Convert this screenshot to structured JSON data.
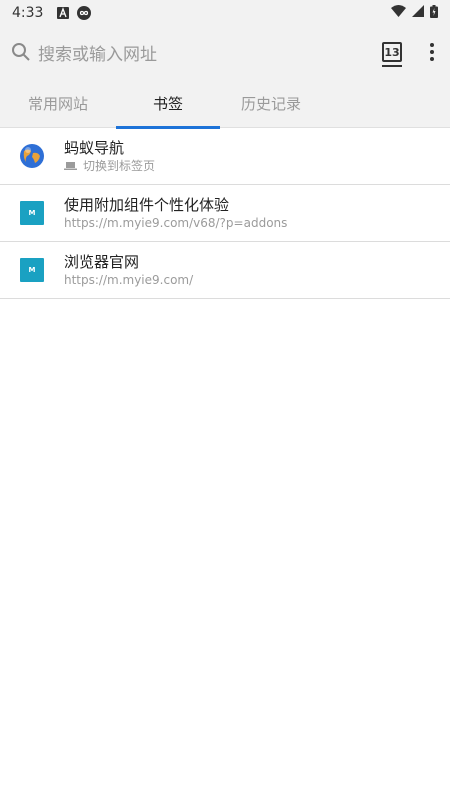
{
  "status_bar": {
    "time": "4:33",
    "icons": [
      "font-icon",
      "infinity-icon",
      "wifi-icon",
      "signal-icon",
      "battery-icon"
    ]
  },
  "toolbar": {
    "search_placeholder": "搜索或输入网址",
    "tab_count": "13"
  },
  "tabs": [
    {
      "label": "常用网站",
      "active": false
    },
    {
      "label": "书签",
      "active": true
    },
    {
      "label": "历史记录",
      "active": false
    }
  ],
  "bookmarks": [
    {
      "title": "蚂蚁导航",
      "subtitle": "切换到标签页",
      "icon": "globe-icon"
    },
    {
      "title": "使用附加组件个性化体验",
      "subtitle": "https://m.myie9.com/v68/?p=addons",
      "icon": "m-site-icon",
      "icon_text": "M"
    },
    {
      "title": "浏览器官网",
      "subtitle": "https://m.myie9.com/",
      "icon": "m-site-icon",
      "icon_text": "M"
    }
  ],
  "colors": {
    "accent": "#1e73d8",
    "toolbar_bg": "#f2f2f2",
    "site_icon": "#1aa1c2"
  }
}
